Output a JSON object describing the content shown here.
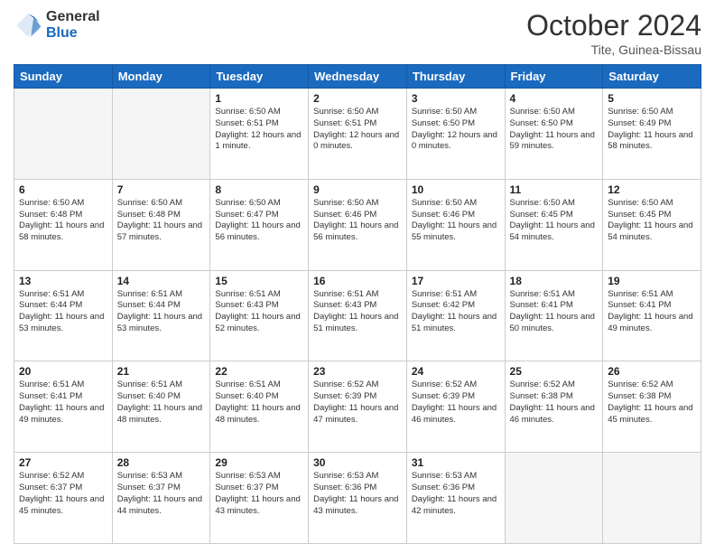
{
  "header": {
    "logo_general": "General",
    "logo_blue": "Blue",
    "month_title": "October 2024",
    "location": "Tite, Guinea-Bissau"
  },
  "weekdays": [
    "Sunday",
    "Monday",
    "Tuesday",
    "Wednesday",
    "Thursday",
    "Friday",
    "Saturday"
  ],
  "weeks": [
    [
      {
        "day": "",
        "empty": true
      },
      {
        "day": "",
        "empty": true
      },
      {
        "day": "1",
        "sunrise": "Sunrise: 6:50 AM",
        "sunset": "Sunset: 6:51 PM",
        "daylight": "Daylight: 12 hours and 1 minute."
      },
      {
        "day": "2",
        "sunrise": "Sunrise: 6:50 AM",
        "sunset": "Sunset: 6:51 PM",
        "daylight": "Daylight: 12 hours and 0 minutes."
      },
      {
        "day": "3",
        "sunrise": "Sunrise: 6:50 AM",
        "sunset": "Sunset: 6:50 PM",
        "daylight": "Daylight: 12 hours and 0 minutes."
      },
      {
        "day": "4",
        "sunrise": "Sunrise: 6:50 AM",
        "sunset": "Sunset: 6:50 PM",
        "daylight": "Daylight: 11 hours and 59 minutes."
      },
      {
        "day": "5",
        "sunrise": "Sunrise: 6:50 AM",
        "sunset": "Sunset: 6:49 PM",
        "daylight": "Daylight: 11 hours and 58 minutes."
      }
    ],
    [
      {
        "day": "6",
        "sunrise": "Sunrise: 6:50 AM",
        "sunset": "Sunset: 6:48 PM",
        "daylight": "Daylight: 11 hours and 58 minutes."
      },
      {
        "day": "7",
        "sunrise": "Sunrise: 6:50 AM",
        "sunset": "Sunset: 6:48 PM",
        "daylight": "Daylight: 11 hours and 57 minutes."
      },
      {
        "day": "8",
        "sunrise": "Sunrise: 6:50 AM",
        "sunset": "Sunset: 6:47 PM",
        "daylight": "Daylight: 11 hours and 56 minutes."
      },
      {
        "day": "9",
        "sunrise": "Sunrise: 6:50 AM",
        "sunset": "Sunset: 6:46 PM",
        "daylight": "Daylight: 11 hours and 56 minutes."
      },
      {
        "day": "10",
        "sunrise": "Sunrise: 6:50 AM",
        "sunset": "Sunset: 6:46 PM",
        "daylight": "Daylight: 11 hours and 55 minutes."
      },
      {
        "day": "11",
        "sunrise": "Sunrise: 6:50 AM",
        "sunset": "Sunset: 6:45 PM",
        "daylight": "Daylight: 11 hours and 54 minutes."
      },
      {
        "day": "12",
        "sunrise": "Sunrise: 6:50 AM",
        "sunset": "Sunset: 6:45 PM",
        "daylight": "Daylight: 11 hours and 54 minutes."
      }
    ],
    [
      {
        "day": "13",
        "sunrise": "Sunrise: 6:51 AM",
        "sunset": "Sunset: 6:44 PM",
        "daylight": "Daylight: 11 hours and 53 minutes."
      },
      {
        "day": "14",
        "sunrise": "Sunrise: 6:51 AM",
        "sunset": "Sunset: 6:44 PM",
        "daylight": "Daylight: 11 hours and 53 minutes."
      },
      {
        "day": "15",
        "sunrise": "Sunrise: 6:51 AM",
        "sunset": "Sunset: 6:43 PM",
        "daylight": "Daylight: 11 hours and 52 minutes."
      },
      {
        "day": "16",
        "sunrise": "Sunrise: 6:51 AM",
        "sunset": "Sunset: 6:43 PM",
        "daylight": "Daylight: 11 hours and 51 minutes."
      },
      {
        "day": "17",
        "sunrise": "Sunrise: 6:51 AM",
        "sunset": "Sunset: 6:42 PM",
        "daylight": "Daylight: 11 hours and 51 minutes."
      },
      {
        "day": "18",
        "sunrise": "Sunrise: 6:51 AM",
        "sunset": "Sunset: 6:41 PM",
        "daylight": "Daylight: 11 hours and 50 minutes."
      },
      {
        "day": "19",
        "sunrise": "Sunrise: 6:51 AM",
        "sunset": "Sunset: 6:41 PM",
        "daylight": "Daylight: 11 hours and 49 minutes."
      }
    ],
    [
      {
        "day": "20",
        "sunrise": "Sunrise: 6:51 AM",
        "sunset": "Sunset: 6:41 PM",
        "daylight": "Daylight: 11 hours and 49 minutes."
      },
      {
        "day": "21",
        "sunrise": "Sunrise: 6:51 AM",
        "sunset": "Sunset: 6:40 PM",
        "daylight": "Daylight: 11 hours and 48 minutes."
      },
      {
        "day": "22",
        "sunrise": "Sunrise: 6:51 AM",
        "sunset": "Sunset: 6:40 PM",
        "daylight": "Daylight: 11 hours and 48 minutes."
      },
      {
        "day": "23",
        "sunrise": "Sunrise: 6:52 AM",
        "sunset": "Sunset: 6:39 PM",
        "daylight": "Daylight: 11 hours and 47 minutes."
      },
      {
        "day": "24",
        "sunrise": "Sunrise: 6:52 AM",
        "sunset": "Sunset: 6:39 PM",
        "daylight": "Daylight: 11 hours and 46 minutes."
      },
      {
        "day": "25",
        "sunrise": "Sunrise: 6:52 AM",
        "sunset": "Sunset: 6:38 PM",
        "daylight": "Daylight: 11 hours and 46 minutes."
      },
      {
        "day": "26",
        "sunrise": "Sunrise: 6:52 AM",
        "sunset": "Sunset: 6:38 PM",
        "daylight": "Daylight: 11 hours and 45 minutes."
      }
    ],
    [
      {
        "day": "27",
        "sunrise": "Sunrise: 6:52 AM",
        "sunset": "Sunset: 6:37 PM",
        "daylight": "Daylight: 11 hours and 45 minutes."
      },
      {
        "day": "28",
        "sunrise": "Sunrise: 6:53 AM",
        "sunset": "Sunset: 6:37 PM",
        "daylight": "Daylight: 11 hours and 44 minutes."
      },
      {
        "day": "29",
        "sunrise": "Sunrise: 6:53 AM",
        "sunset": "Sunset: 6:37 PM",
        "daylight": "Daylight: 11 hours and 43 minutes."
      },
      {
        "day": "30",
        "sunrise": "Sunrise: 6:53 AM",
        "sunset": "Sunset: 6:36 PM",
        "daylight": "Daylight: 11 hours and 43 minutes."
      },
      {
        "day": "31",
        "sunrise": "Sunrise: 6:53 AM",
        "sunset": "Sunset: 6:36 PM",
        "daylight": "Daylight: 11 hours and 42 minutes."
      },
      {
        "day": "",
        "empty": true
      },
      {
        "day": "",
        "empty": true
      }
    ]
  ]
}
